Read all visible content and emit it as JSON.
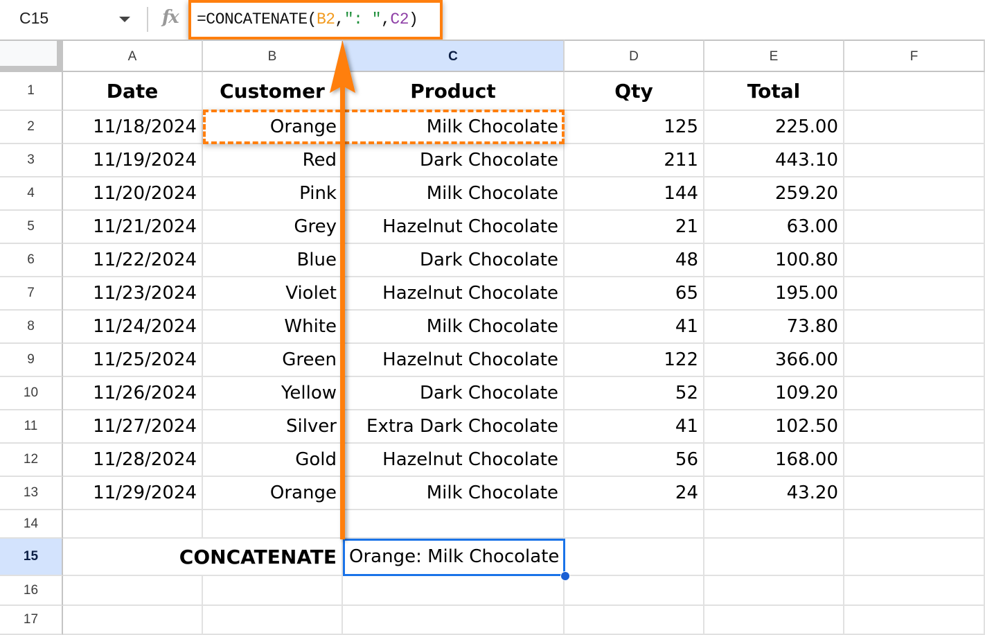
{
  "formula_bar": {
    "name_box": "C15",
    "fx_label": "fx",
    "formula_prefix": "=CONCATENATE(",
    "formula_ref1": "B2",
    "formula_comma1": ",",
    "formula_string": "\": \"",
    "formula_comma2": ",",
    "formula_ref2": "C2",
    "formula_suffix": ")",
    "full_formula": "=CONCATENATE(B2,\": \",C2)"
  },
  "columns": [
    "A",
    "B",
    "C",
    "D",
    "E",
    "F"
  ],
  "selected_column": "C",
  "selected_row": "15",
  "row_numbers": [
    "1",
    "2",
    "3",
    "4",
    "5",
    "6",
    "7",
    "8",
    "9",
    "10",
    "11",
    "12",
    "13",
    "14",
    "15",
    "16",
    "17"
  ],
  "headers": {
    "date": "Date",
    "customer": "Customer",
    "product": "Product",
    "qty": "Qty",
    "total": "Total"
  },
  "rows": [
    {
      "date": "11/18/2024",
      "customer": "Orange",
      "product": "Milk Chocolate",
      "qty": "125",
      "total": "225.00"
    },
    {
      "date": "11/19/2024",
      "customer": "Red",
      "product": "Dark Chocolate",
      "qty": "211",
      "total": "443.10"
    },
    {
      "date": "11/20/2024",
      "customer": "Pink",
      "product": "Milk Chocolate",
      "qty": "144",
      "total": "259.20"
    },
    {
      "date": "11/21/2024",
      "customer": "Grey",
      "product": "Hazelnut Chocolate",
      "qty": "21",
      "total": "63.00"
    },
    {
      "date": "11/22/2024",
      "customer": "Blue",
      "product": "Dark Chocolate",
      "qty": "48",
      "total": "100.80"
    },
    {
      "date": "11/23/2024",
      "customer": "Violet",
      "product": "Hazelnut Chocolate",
      "qty": "65",
      "total": "195.00"
    },
    {
      "date": "11/24/2024",
      "customer": "White",
      "product": "Milk Chocolate",
      "qty": "41",
      "total": "73.80"
    },
    {
      "date": "11/25/2024",
      "customer": "Green",
      "product": "Hazelnut Chocolate",
      "qty": "122",
      "total": "366.00"
    },
    {
      "date": "11/26/2024",
      "customer": "Yellow",
      "product": "Dark Chocolate",
      "qty": "52",
      "total": "109.20"
    },
    {
      "date": "11/27/2024",
      "customer": "Silver",
      "product": "Extra Dark Chocolate",
      "qty": "41",
      "total": "102.50"
    },
    {
      "date": "11/28/2024",
      "customer": "Gold",
      "product": "Hazelnut Chocolate",
      "qty": "56",
      "total": "168.00"
    },
    {
      "date": "11/29/2024",
      "customer": "Orange",
      "product": "Milk Chocolate",
      "qty": "24",
      "total": "43.20"
    }
  ],
  "result_row": {
    "label": "CONCATENATE",
    "value": "Orange: Milk Chocolate"
  },
  "colors": {
    "annotation_orange": "#ff7f0e",
    "selection_blue": "#1a73e8",
    "header_selected_bg": "#d3e3fd",
    "ref1_color": "#f29b1f",
    "string_color": "#1e8f3a",
    "ref2_color": "#8e3fa6"
  }
}
